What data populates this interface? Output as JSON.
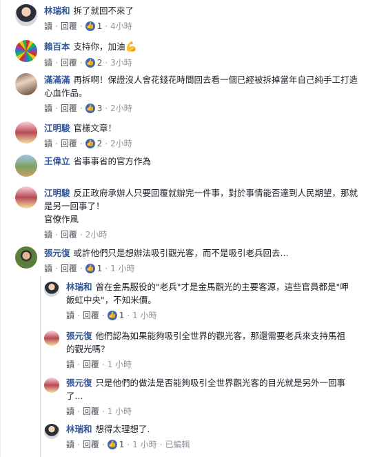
{
  "comments": [
    {
      "name": "林瑞和",
      "text": "拆了就回不來了",
      "read": "讀",
      "reply": "回覆",
      "likes": "1",
      "time": "4小時"
    },
    {
      "name": "賴百本",
      "text": "支持你，加油",
      "emoji": "💪",
      "read": "讀",
      "reply": "回覆",
      "likes": "2",
      "time": "3小時"
    },
    {
      "name": "滿滿滿",
      "text": "再拆啊！保證沒人會花錢花時間回去看一個已經被拆掉當年自己純手工打造心血作品。",
      "read": "讀",
      "reply": "回覆",
      "likes": "3",
      "time": "2小時"
    },
    {
      "name": "江明駿",
      "text": "官樣文章！",
      "read": "讀",
      "reply": "回覆",
      "likes": "2",
      "time": "2小時"
    },
    {
      "name": "王偉立",
      "text": "省事事省的官方作為"
    },
    {
      "name": "江明駿",
      "text": "反正政府承辦人只要回覆就辦完一件事，對於事情能否達到人民期望，那就是另一回事了！",
      "text2": "官僚作風",
      "read": "讀",
      "reply": "回覆",
      "time": "2小時"
    },
    {
      "name": "張元復",
      "text": "或許他們只是想辦法吸引觀光客，而不是吸引老兵回去...",
      "read": "讀",
      "reply": "回覆",
      "likes": "1",
      "time": "1 小時"
    }
  ],
  "replies": [
    {
      "name": "林瑞和",
      "text": "曾在金馬服役的\"老兵\"才是金馬觀光的主要客源，這些官員都是\"呷飯虹中央\"，不知米價。",
      "read": "讀",
      "reply": "回覆",
      "likes": "1",
      "time": "1 小時"
    },
    {
      "name": "張元復",
      "text": "他們認為如果能夠吸引全世界的觀光客，那還需要老兵來支持馬祖的觀光嗎？",
      "read": "讀",
      "reply": "回覆",
      "time": "1 小時"
    },
    {
      "name": "張元復",
      "text": "只是他們的做法是否能夠吸引全世界觀光客的目光就是另外一回事了...",
      "read": "讀",
      "reply": "回覆",
      "time": "1 小時"
    },
    {
      "name": "林瑞和",
      "text": "想得太理想了.",
      "read": "讀",
      "reply": "回覆",
      "likes": "1",
      "time": "1 小時",
      "edited": "已編輯"
    }
  ]
}
